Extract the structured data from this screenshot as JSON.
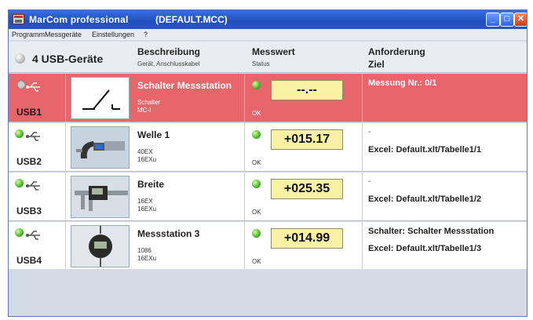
{
  "window": {
    "title": "MarCom professional",
    "file": "(DEFAULT.MCC)"
  },
  "menu": [
    "Programm",
    "Messgeräte",
    "Einstellungen",
    "?"
  ],
  "header": {
    "device_count": "4 USB-Geräte",
    "col_description": "Beschreibung",
    "col_description_sub": "Gerät, Anschlusskabel",
    "col_value": "Messwert",
    "col_value_sub": "Status",
    "col_request": "Anforderung",
    "col_target": "Ziel"
  },
  "rows": [
    {
      "port": "USB1",
      "name": "Schalter Messstation",
      "device": "Schalter",
      "cable": "MC-I",
      "value": "--.--",
      "status": "OK",
      "request": "Messung Nr.: 0/1",
      "target": "",
      "led": "grey",
      "thumb": "switch-icon",
      "highlight": "#e8666b"
    },
    {
      "port": "USB2",
      "name": "Welle 1",
      "device": "40EX",
      "cable": "16EXu",
      "value": "+015.17",
      "status": "OK",
      "request": "-",
      "target": "Excel: Default.xlt/Tabelle1/1",
      "led": "green",
      "thumb": "micrometer-icon"
    },
    {
      "port": "USB3",
      "name": "Breite",
      "device": "16EX",
      "cable": "16EXu",
      "value": "+025.35",
      "status": "OK",
      "request": "-",
      "target": "Excel: Default.xlt/Tabelle1/2",
      "led": "green",
      "thumb": "caliper-icon"
    },
    {
      "port": "USB4",
      "name": "Messstation 3",
      "device": "1086",
      "cable": "16EXu",
      "value": "+014.99",
      "status": "OK",
      "request": "Schalter: Schalter Messstation",
      "target": "Excel: Default.xlt/Tabelle1/3",
      "led": "green",
      "thumb": "dial-indicator-icon"
    }
  ]
}
